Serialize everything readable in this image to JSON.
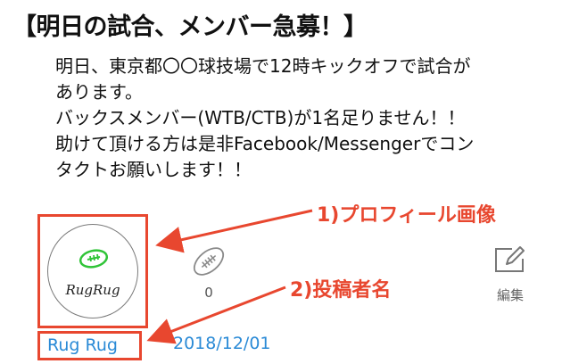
{
  "post": {
    "title": "【明日の試合、メンバー急募！】",
    "body": [
      "明日、東京都〇〇球技場で12時キックオフで試合が",
      "あります。",
      "バックスメンバー(WTB/CTB)が1名足りません！！",
      "助けて頂ける方は是非Facebook/Messengerでコン",
      "タクトお願いします！！"
    ],
    "avatar_logo_text": "RugRug",
    "like_count": "0",
    "edit_label": "編集",
    "author": "Rug Rug",
    "date": "2018/12/01"
  },
  "annotations": {
    "profile_image": "1)プロフィール画像",
    "author_name": "2)投稿者名"
  },
  "colors": {
    "highlight": "#e8472f",
    "link": "#2a8ad6",
    "ball_green": "#2fc437"
  },
  "icons": [
    "rugby-ball-icon",
    "edit-icon"
  ]
}
